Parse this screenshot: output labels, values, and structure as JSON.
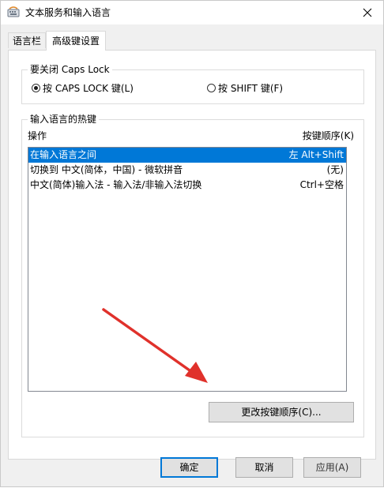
{
  "window": {
    "title": "文本服务和输入语言",
    "icon": "keyboard-icon",
    "close": "close-icon"
  },
  "tabs": [
    {
      "label": "语言栏",
      "active": false
    },
    {
      "label": "高级键设置",
      "active": true
    }
  ],
  "caps_group": {
    "label": "要关闭 Caps Lock",
    "options": [
      {
        "label": "按 CAPS LOCK 键(L)",
        "checked": true
      },
      {
        "label": "按 SHIFT 键(F)",
        "checked": false
      }
    ]
  },
  "hotkey_group": {
    "label": "输入语言的热键",
    "columns": {
      "action": "操作",
      "order": "按键顺序(K)"
    },
    "rows": [
      {
        "action": "在输入语言之间",
        "keys": "左 Alt+Shift",
        "selected": true
      },
      {
        "action": "切换到 中文(简体，中国) - 微软拼音",
        "keys": "(无)",
        "selected": false
      },
      {
        "action": "中文(简体)输入法 - 输入法/非输入法切换",
        "keys": "Ctrl+空格",
        "selected": false
      }
    ],
    "change_button": "更改按键顺序(C)..."
  },
  "footer": {
    "ok": "确定",
    "cancel": "取消",
    "apply": "应用(A)"
  },
  "colors": {
    "selection": "#0078d7",
    "annotation_arrow": "#e0312b"
  }
}
